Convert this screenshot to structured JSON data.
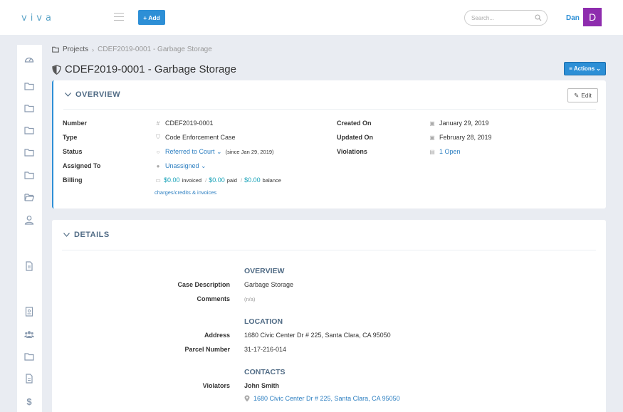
{
  "app": {
    "logo": "viva"
  },
  "topbar": {
    "add_label": "Add",
    "search_placeholder": "Search...",
    "user_name": "Dan",
    "avatar_letter": "D"
  },
  "breadcrumb": {
    "root": "Projects",
    "current": "CDEF2019-0001 - Garbage Storage"
  },
  "page": {
    "title": "CDEF2019-0001 - Garbage Storage",
    "actions_label": "Actions"
  },
  "overview": {
    "heading": "OVERVIEW",
    "edit_label": "Edit",
    "number_label": "Number",
    "number_value": "CDEF2019-0001",
    "type_label": "Type",
    "type_value": "Code Enforcement Case",
    "status_label": "Status",
    "status_value": "Referred to Court",
    "status_since": "(since Jan 29, 2019)",
    "assigned_label": "Assigned To",
    "assigned_value": "Unassigned",
    "billing_label": "Billing",
    "invoiced_amount": "$0.00",
    "invoiced_text": "invoiced",
    "paid_amount": "$0.00",
    "paid_text": "paid",
    "balance_amount": "$0.00",
    "balance_text": "balance",
    "billing_link": "charges/credits & invoices",
    "created_label": "Created On",
    "created_value": "January 29, 2019",
    "updated_label": "Updated On",
    "updated_value": "February 28, 2019",
    "violations_label": "Violations",
    "violations_value": "1 Open"
  },
  "details": {
    "heading": "DETAILS",
    "overview_head": "OVERVIEW",
    "case_desc_label": "Case Description",
    "case_desc_value": "Garbage Storage",
    "comments_label": "Comments",
    "comments_value": "(n/a)",
    "location_head": "LOCATION",
    "address_label": "Address",
    "address_value": "1680 Civic Center Dr # 225, Santa Clara, CA 95050",
    "parcel_label": "Parcel Number",
    "parcel_value": "31-17-216-014",
    "contacts_head": "CONTACTS",
    "violators_label": "Violators",
    "violator_name": "John Smith",
    "violator_address": "1680 Civic Center Dr # 225, Santa Clara, CA 95050"
  },
  "colors": {
    "accent": "#2d8fd6",
    "avatar": "#8e2cae",
    "money": "#18a2b8",
    "heading": "#506b85"
  },
  "sidebar_icons": [
    "dashboard-icon",
    "folder-icon",
    "folder-icon",
    "folder-icon",
    "folder-icon",
    "folder-icon",
    "folder-open-icon",
    "user-icon",
    "document-icon",
    "contact-card-icon",
    "users-icon",
    "folder-icon",
    "document-icon",
    "dollar-icon"
  ]
}
